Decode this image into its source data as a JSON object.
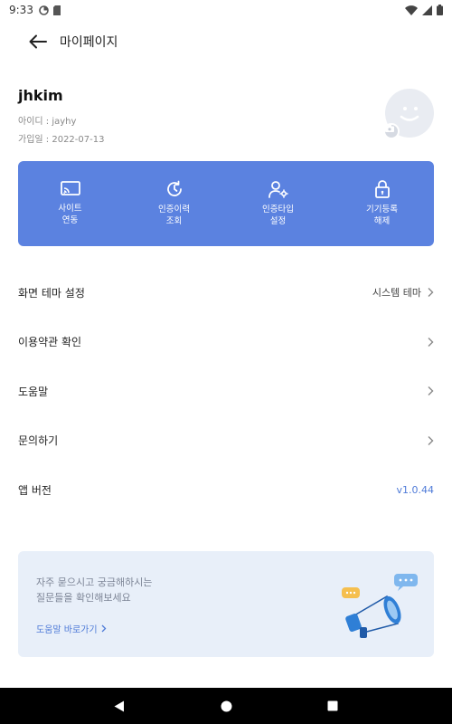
{
  "status_bar": {
    "time": "9:33"
  },
  "header": {
    "title": "마이페이지"
  },
  "profile": {
    "username": "jhkim",
    "id_label": "아이디 :",
    "id_value": "jayhy",
    "joined_label": "가입일 :",
    "joined_value": "2022-07-13"
  },
  "quick_actions": [
    {
      "label": "사이트\n연동",
      "icon": "cast-icon"
    },
    {
      "label": "인증이력\n조회",
      "icon": "history-icon"
    },
    {
      "label": "인증타입\n설정",
      "icon": "user-settings-icon"
    },
    {
      "label": "기기등록\n해제",
      "icon": "unlock-icon"
    }
  ],
  "menu": [
    {
      "label": "화면 테마 설정",
      "value": "시스템 테마"
    },
    {
      "label": "이용약관 확인"
    },
    {
      "label": "도움말"
    },
    {
      "label": "문의하기"
    },
    {
      "label": "앱 버전",
      "value": "v1.0.44"
    }
  ],
  "faq_banner": {
    "text": "자주 묻으시고 궁금해하시는\n질문들을 확인해보세요",
    "link_label": "도움말 바로가기"
  },
  "colors": {
    "accent": "#5b82e0",
    "link": "#4f7bd8",
    "banner_bg": "#e8eff9"
  }
}
